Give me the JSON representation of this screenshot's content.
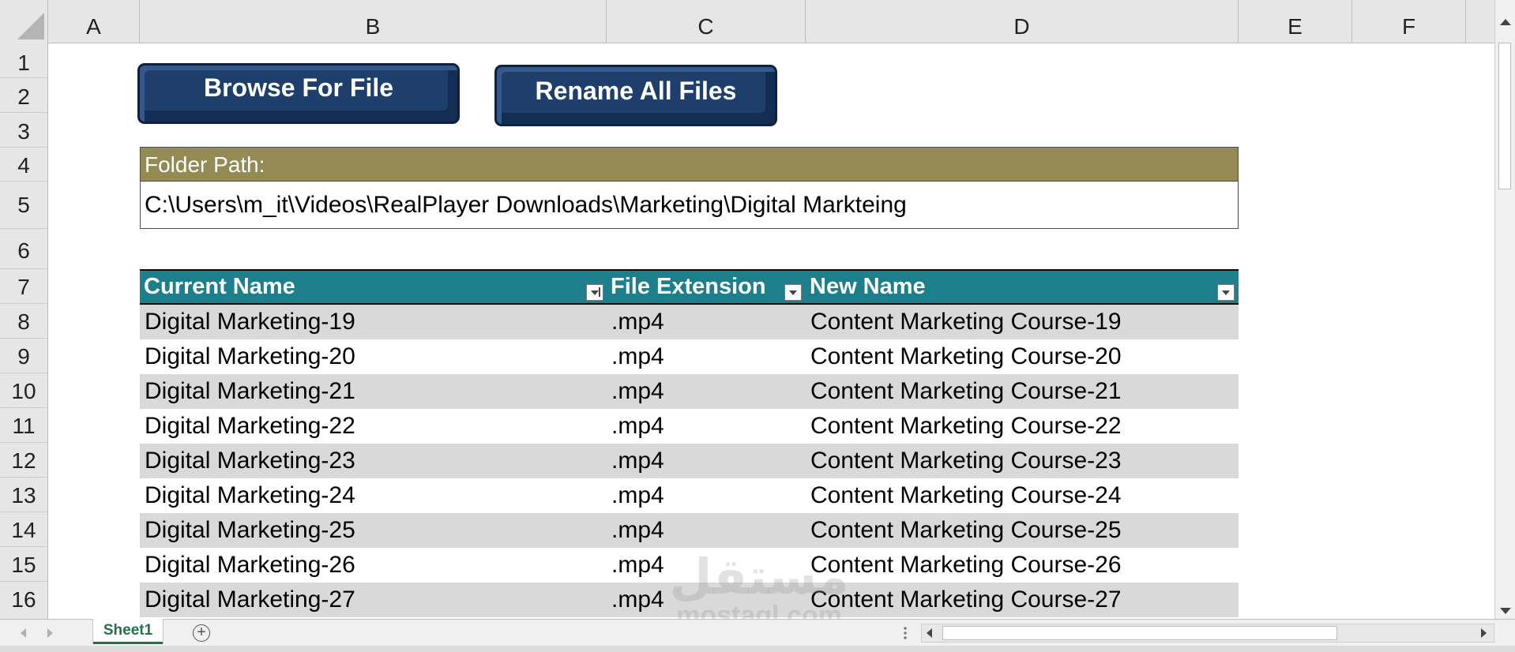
{
  "columns": [
    "A",
    "B",
    "C",
    "D",
    "E",
    "F"
  ],
  "rows": [
    "1",
    "2",
    "3",
    "4",
    "5",
    "6",
    "7",
    "8",
    "9",
    "10",
    "11",
    "12",
    "13",
    "14",
    "15",
    "16"
  ],
  "buttons": {
    "browse_label": "Browse For File",
    "rename_label": "Rename All Files"
  },
  "folder": {
    "label": "Folder Path:",
    "path": "C:\\Users\\m_it\\Videos\\RealPlayer Downloads\\Marketing\\Digital Markteing"
  },
  "table": {
    "headers": [
      "Current Name",
      "File Extension",
      "New Name"
    ],
    "rows": [
      {
        "current": "Digital Marketing-19",
        "ext": ".mp4",
        "new": "Content Marketing Course-19"
      },
      {
        "current": "Digital Marketing-20",
        "ext": ".mp4",
        "new": "Content Marketing Course-20"
      },
      {
        "current": "Digital Marketing-21",
        "ext": ".mp4",
        "new": "Content Marketing Course-21"
      },
      {
        "current": "Digital Marketing-22",
        "ext": ".mp4",
        "new": "Content Marketing Course-22"
      },
      {
        "current": "Digital Marketing-23",
        "ext": ".mp4",
        "new": "Content Marketing Course-23"
      },
      {
        "current": "Digital Marketing-24",
        "ext": ".mp4",
        "new": "Content Marketing Course-24"
      },
      {
        "current": "Digital Marketing-25",
        "ext": ".mp4",
        "new": "Content Marketing Course-25"
      },
      {
        "current": "Digital Marketing-26",
        "ext": ".mp4",
        "new": "Content Marketing Course-26"
      },
      {
        "current": "Digital Marketing-27",
        "ext": ".mp4",
        "new": "Content Marketing Course-27"
      }
    ]
  },
  "sheet_tab": "Sheet1",
  "watermark": {
    "arabic": "مستقل",
    "latin": "mostaql.com"
  },
  "colors": {
    "button": "#1e3f6b",
    "folder_header": "#948a54",
    "table_header": "#1e7f8c",
    "banded_row": "#d9d9d9",
    "sheet_tab_text": "#217346"
  }
}
